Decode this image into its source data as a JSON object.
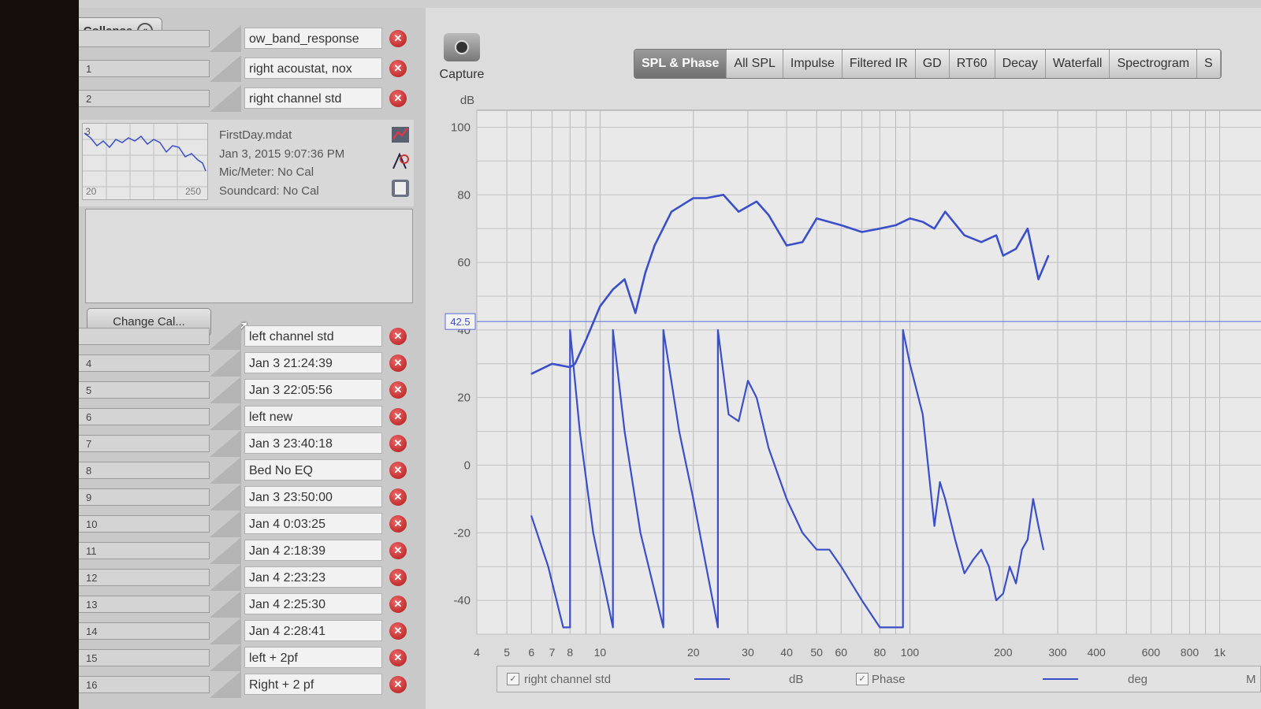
{
  "measurements": {
    "collapse_label": "Collapse",
    "top_items": [
      {
        "num": "",
        "name": "ow_band_response"
      },
      {
        "num": "1",
        "name": "right acoustat, nox"
      },
      {
        "num": "2",
        "name": "right channel std"
      }
    ],
    "selected": {
      "thumb_num": "3",
      "thumb_xmin": "20",
      "thumb_xmax": "250",
      "file": "FirstDay.mdat",
      "date": "Jan 3, 2015 9:07:36 PM",
      "mic": "Mic/Meter: No Cal",
      "soundcard": "Soundcard: No Cal"
    },
    "change_cal_label": "Change Cal...",
    "items": [
      {
        "num": "",
        "name": "left channel std"
      },
      {
        "num": "4",
        "name": "Jan 3 21:24:39"
      },
      {
        "num": "5",
        "name": "Jan 3 22:05:56"
      },
      {
        "num": "6",
        "name": "left new"
      },
      {
        "num": "7",
        "name": "Jan 3 23:40:18"
      },
      {
        "num": "8",
        "name": "Bed No EQ"
      },
      {
        "num": "9",
        "name": "Jan 3 23:50:00"
      },
      {
        "num": "10",
        "name": "Jan 4 0:03:25"
      },
      {
        "num": "11",
        "name": "Jan 4 2:18:39"
      },
      {
        "num": "12",
        "name": "Jan 4 2:23:23"
      },
      {
        "num": "13",
        "name": "Jan 4 2:25:30"
      },
      {
        "num": "14",
        "name": "Jan 4 2:28:41"
      },
      {
        "num": "15",
        "name": "left + 2pf"
      },
      {
        "num": "16",
        "name": "Right + 2 pf"
      }
    ]
  },
  "capture_label": "Capture",
  "tabs": [
    "SPL & Phase",
    "All SPL",
    "Impulse",
    "Filtered IR",
    "GD",
    "RT60",
    "Decay",
    "Waterfall",
    "Spectrogram",
    "S"
  ],
  "active_tab": "SPL & Phase",
  "chart_data": {
    "type": "line",
    "yunit": "dB",
    "x_scale": "log",
    "xlim": [
      4,
      1400
    ],
    "ylim": [
      -50,
      105
    ],
    "y_ticks": [
      100,
      80,
      60,
      40,
      20,
      0,
      -20,
      -40
    ],
    "x_ticks": [
      4,
      5,
      6,
      7,
      8,
      10,
      20,
      30,
      40,
      50,
      60,
      80,
      100,
      200,
      300,
      400,
      600,
      800,
      1000
    ],
    "x_tick_labels": [
      "4",
      "5",
      "6",
      "7",
      "8",
      "10",
      "20",
      "30",
      "40",
      "50",
      "60",
      "80",
      "100",
      "200",
      "300",
      "400",
      "600",
      "800",
      "1k"
    ],
    "cursor_value": "42.5",
    "series": [
      {
        "name": "right channel std",
        "unit": "dB",
        "color": "#3a4fc8",
        "x": [
          6,
          7,
          8,
          8.3,
          9,
          10,
          11,
          12,
          13,
          14,
          15,
          17,
          20,
          22,
          25,
          28,
          32,
          35,
          40,
          45,
          50,
          60,
          70,
          80,
          90,
          100,
          110,
          120,
          130,
          150,
          170,
          190,
          200,
          220,
          240,
          260,
          280
        ],
        "y": [
          27,
          30,
          29,
          30,
          37,
          47,
          52,
          55,
          45,
          57,
          65,
          75,
          79,
          79,
          80,
          75,
          78,
          74,
          65,
          66,
          73,
          71,
          69,
          70,
          71,
          73,
          72,
          70,
          75,
          68,
          66,
          68,
          62,
          64,
          70,
          55,
          62
        ]
      },
      {
        "name": "Phase",
        "unit": "deg",
        "color": "#3a4fc8",
        "x": [
          6,
          6.8,
          7.6,
          8,
          8,
          8.6,
          9.5,
          11,
          11,
          12,
          13.5,
          16,
          16,
          18,
          20,
          22,
          24,
          24,
          26,
          28,
          30,
          32,
          35,
          40,
          45,
          50,
          55,
          60,
          70,
          80,
          90,
          95,
          95,
          100,
          110,
          120,
          125,
          130,
          140,
          150,
          160,
          170,
          180,
          190,
          200,
          210,
          220,
          230,
          240,
          250,
          260,
          270
        ],
        "y": [
          -15,
          -30,
          -48,
          -48,
          40,
          10,
          -20,
          -48,
          40,
          10,
          -20,
          -48,
          40,
          10,
          -10,
          -30,
          -48,
          40,
          15,
          13,
          25,
          20,
          5,
          -10,
          -20,
          -25,
          -25,
          -30,
          -40,
          -48,
          -48,
          -48,
          40,
          30,
          15,
          -18,
          -5,
          -10,
          -22,
          -32,
          -28,
          -25,
          -30,
          -40,
          -38,
          -30,
          -35,
          -25,
          -22,
          -10,
          -18,
          -25
        ]
      }
    ]
  },
  "legend": {
    "series_name": "right channel std",
    "series_unit": "dB",
    "phase_label": "Phase",
    "phase_unit": "deg",
    "right_cut": "M"
  }
}
